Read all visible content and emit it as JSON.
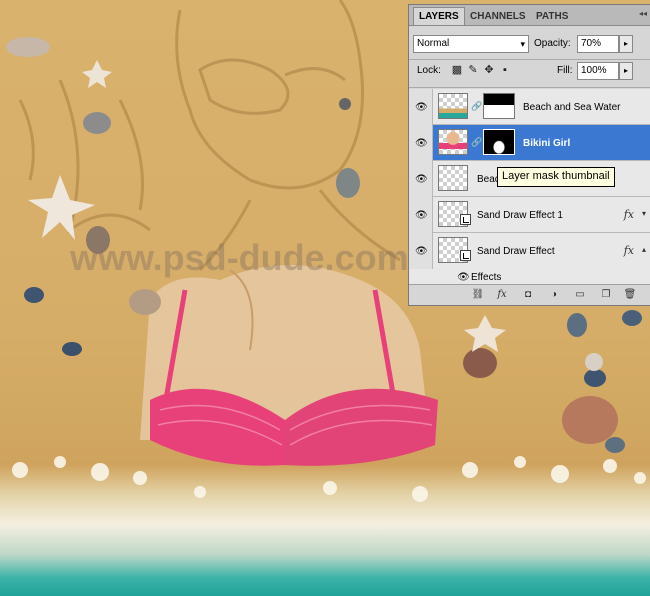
{
  "panel": {
    "tabs": [
      {
        "label": "LAYERS",
        "active": true
      },
      {
        "label": "CHANNELS",
        "active": false
      },
      {
        "label": "PATHS",
        "active": false
      }
    ],
    "blend_mode": "Normal",
    "opacity_label": "Opacity:",
    "opacity_value": "70%",
    "lock_label": "Lock:",
    "fill_label": "Fill:",
    "fill_value": "100%",
    "layers": [
      {
        "name": "Beach and Sea Water",
        "visible": true,
        "selected": false,
        "has_mask": true
      },
      {
        "name": "Bikini Girl",
        "visible": true,
        "selected": true,
        "has_mask": true
      },
      {
        "name": "Beach",
        "visible": true,
        "selected": false,
        "has_mask": false
      },
      {
        "name": "Sand Draw Effect 1",
        "visible": true,
        "selected": false,
        "fx": "fx"
      },
      {
        "name": "Sand Draw Effect",
        "visible": true,
        "selected": false,
        "fx": "fx"
      }
    ],
    "effects_label": "Effects"
  },
  "tooltip": "Layer mask thumbnail",
  "watermark": "www.psd-dude.com",
  "colors": {
    "selection": "#3a78d2",
    "sand": "#d6ad68",
    "sea": "#21a39a",
    "bikini": "#e8417a"
  }
}
